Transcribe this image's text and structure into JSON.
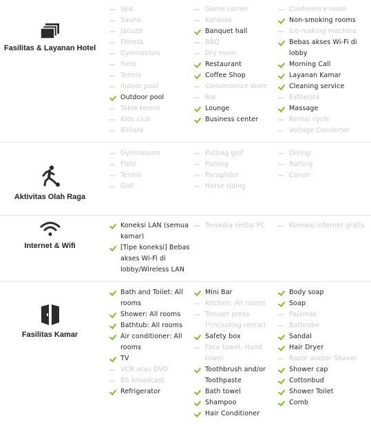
{
  "sections": [
    {
      "title": "Fasilitas & Layanan Hotel",
      "icon": "stacked-layers-icon",
      "columns": [
        [
          {
            "label": "Spa",
            "available": false
          },
          {
            "label": "Sauna",
            "available": false
          },
          {
            "label": "Jacuzzi",
            "available": false
          },
          {
            "label": "Fitness",
            "available": false
          },
          {
            "label": "Gymnasium",
            "available": false
          },
          {
            "label": "Field",
            "available": false
          },
          {
            "label": "Tennis",
            "available": false
          },
          {
            "label": "Indoor pool",
            "available": false
          },
          {
            "label": "Outdoor pool",
            "available": true
          },
          {
            "label": "Table tennis",
            "available": false
          },
          {
            "label": "Kids club",
            "available": false
          },
          {
            "label": "Billiard",
            "available": false
          }
        ],
        [
          {
            "label": "Game corner",
            "available": false
          },
          {
            "label": "Karaoke",
            "available": false
          },
          {
            "label": "Banquet hall",
            "available": true
          },
          {
            "label": "BBQ",
            "available": false
          },
          {
            "label": "Dry room",
            "available": false
          },
          {
            "label": "Restaurant",
            "available": true
          },
          {
            "label": "Coffee Shop",
            "available": true
          },
          {
            "label": "Convenience store",
            "available": false
          },
          {
            "label": "Bar",
            "available": false
          },
          {
            "label": "Lounge",
            "available": true
          },
          {
            "label": "Business center",
            "available": true
          }
        ],
        [
          {
            "label": "Conference room",
            "available": false
          },
          {
            "label": "Non-smoking rooms",
            "available": true
          },
          {
            "label": "Ice-making machine",
            "available": false
          },
          {
            "label": "Bebas akses Wi-Fi di lobby",
            "available": true
          },
          {
            "label": "Morning Call",
            "available": true
          },
          {
            "label": "Layanan Kamar",
            "available": true
          },
          {
            "label": "Cleaning service",
            "available": true
          },
          {
            "label": "Esthetics",
            "available": false
          },
          {
            "label": "Massage",
            "available": true
          },
          {
            "label": "Rental cycle",
            "available": false
          },
          {
            "label": "Voltage Converter",
            "available": false
          }
        ]
      ]
    },
    {
      "title": "Aktivitas Olah Raga",
      "icon": "football-player-icon",
      "columns": [
        [
          {
            "label": "Gymnasium",
            "available": false
          },
          {
            "label": "Field",
            "available": false
          },
          {
            "label": "Tennis",
            "available": false
          },
          {
            "label": "Golf",
            "available": false
          }
        ],
        [
          {
            "label": "Putting golf",
            "available": false
          },
          {
            "label": "Fishing",
            "available": false
          },
          {
            "label": "Paraglider",
            "available": false
          },
          {
            "label": "Horse riding",
            "available": false
          }
        ],
        [
          {
            "label": "Diving",
            "available": false
          },
          {
            "label": "Rafting",
            "available": false
          },
          {
            "label": "Canoe",
            "available": false
          }
        ]
      ]
    },
    {
      "title": "Internet & Wifi",
      "icon": "wifi-icon",
      "columns": [
        [
          {
            "label": "Koneksi LAN (semua kamar)",
            "available": true
          },
          {
            "label": "[Tipe koneksi] Bebas akses Wi-Fi di lobby/Wireless LAN",
            "available": true
          }
        ],
        [
          {
            "label": "Tersedia rental PC",
            "available": false
          }
        ],
        [
          {
            "label": "Koneksi internet gratis",
            "available": false
          }
        ]
      ]
    },
    {
      "title": "Fasilitas Kamar",
      "icon": "room-door-icon",
      "columns": [
        [
          {
            "label": "Bath and Toilet: All rooms",
            "available": true
          },
          {
            "label": "Shower: All rooms",
            "available": true
          },
          {
            "label": "Bathtub: All rooms",
            "available": true
          },
          {
            "label": "Air conditioner: All rooms",
            "available": true
          },
          {
            "label": "TV",
            "available": true
          },
          {
            "label": "VCR atau DVD",
            "available": false
          },
          {
            "label": "BS broadcast",
            "available": false
          },
          {
            "label": "Refrigerator",
            "available": true
          }
        ],
        [
          {
            "label": "Mini Bar",
            "available": true
          },
          {
            "label": "Kitchen: All rooms",
            "available": false
          },
          {
            "label": "Trouser press (*including rental)",
            "available": false
          },
          {
            "label": "Safety box",
            "available": true
          },
          {
            "label": "Face towel, Hand towel",
            "available": false
          },
          {
            "label": "Toothbrush and/or Toothpaste",
            "available": true
          },
          {
            "label": "Bath towel",
            "available": true
          },
          {
            "label": "Shampoo",
            "available": true
          },
          {
            "label": "Hair Conditioner",
            "available": true
          }
        ],
        [
          {
            "label": "Body soap",
            "available": true
          },
          {
            "label": "Soap",
            "available": true
          },
          {
            "label": "Pajamas",
            "available": false
          },
          {
            "label": "Bathrobe",
            "available": false
          },
          {
            "label": "Sandal",
            "available": true
          },
          {
            "label": "Hair Dryer",
            "available": true
          },
          {
            "label": "Razor and/or Shaver",
            "available": false
          },
          {
            "label": "Shower cap",
            "available": true
          },
          {
            "label": "Cottonbud",
            "available": true
          },
          {
            "label": "Shower Toilet",
            "available": true
          },
          {
            "label": "Comb",
            "available": true
          }
        ]
      ]
    }
  ]
}
